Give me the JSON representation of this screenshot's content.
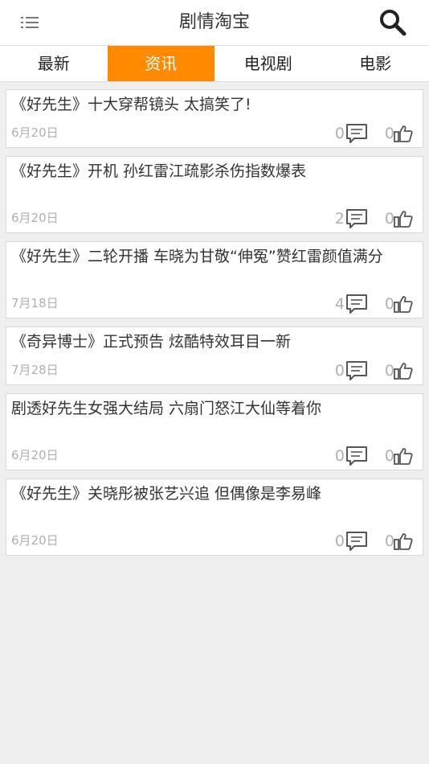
{
  "header": {
    "title": "剧情淘宝",
    "menu_icon": "list-menu-icon",
    "search_icon": "search-icon"
  },
  "tabs": [
    {
      "label": "最新",
      "active": false
    },
    {
      "label": "资讯",
      "active": true
    },
    {
      "label": "电视剧",
      "active": false
    },
    {
      "label": "电影",
      "active": false
    }
  ],
  "colors": {
    "accent": "#ff8a00",
    "background": "#efefef",
    "muted_text": "#b0b0b0"
  },
  "articles": [
    {
      "title": "《好先生》十大穿帮镜头 太搞笑了!",
      "date": "6月20日",
      "comments": "0",
      "likes": "0"
    },
    {
      "title": "《好先生》开机 孙红雷江疏影杀伤指数爆表",
      "date": "6月20日",
      "comments": "2",
      "likes": "0"
    },
    {
      "title": "《好先生》二轮开播 车晓为甘敬“伸冤”赞红雷颜值满分",
      "date": "7月18日",
      "comments": "4",
      "likes": "0"
    },
    {
      "title": "《奇异博士》正式预告 炫酷特效耳目一新",
      "date": "7月28日",
      "comments": "0",
      "likes": "0"
    },
    {
      "title": "剧透好先生女强大结局 六扇门怒江大仙等着你",
      "date": "6月20日",
      "comments": "0",
      "likes": "0"
    },
    {
      "title": "《好先生》关晓彤被张艺兴追 但偶像是李易峰",
      "date": "6月20日",
      "comments": "0",
      "likes": "0"
    }
  ]
}
